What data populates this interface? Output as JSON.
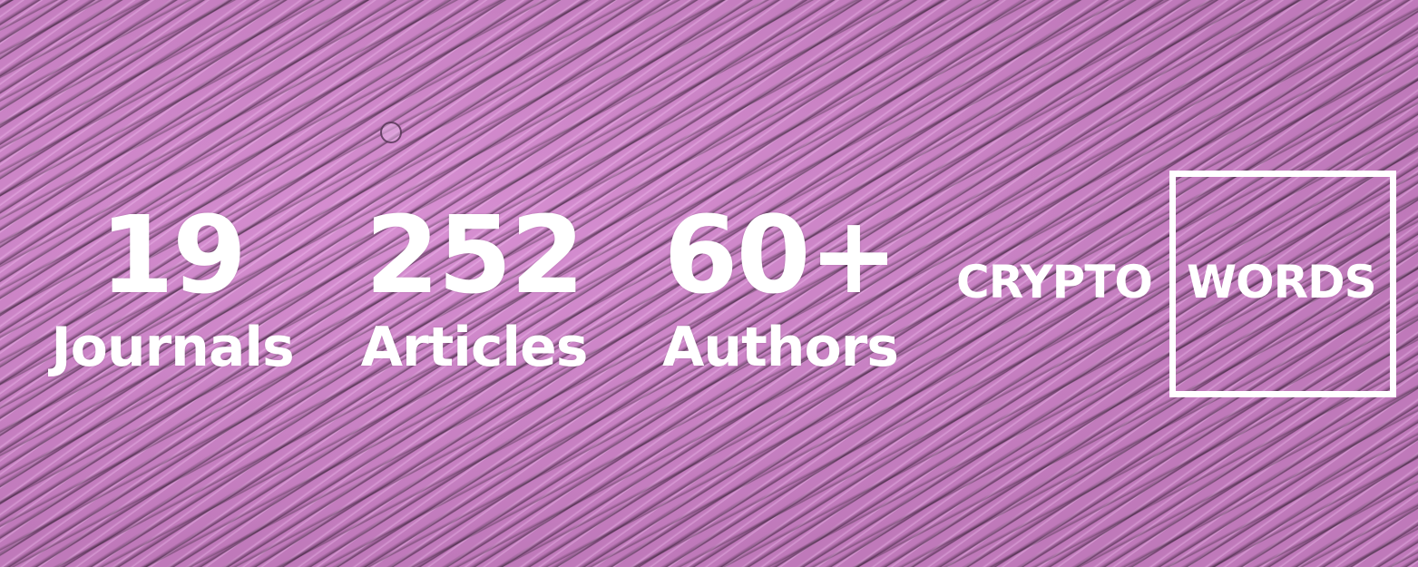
{
  "stats": [
    {
      "number": "19",
      "label": "Journals"
    },
    {
      "number": "252",
      "label": "Articles"
    },
    {
      "number": "60+",
      "label": "Authors"
    }
  ],
  "logo": {
    "left_word": "CRYPTO",
    "right_word": "WORDS"
  },
  "colors": {
    "background": "#c97fc4",
    "text": "#ffffff"
  }
}
